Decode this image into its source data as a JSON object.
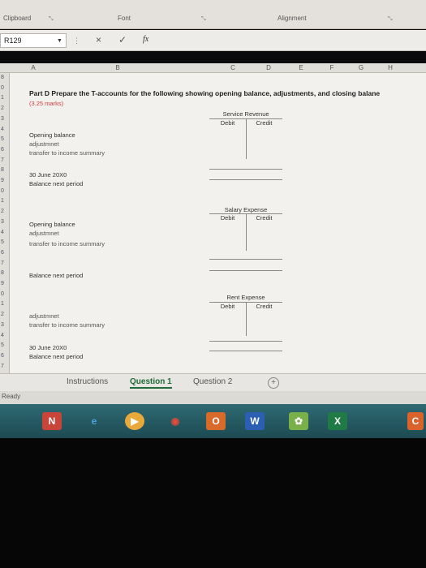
{
  "ribbon": {
    "groups": [
      "Clipboard",
      "Font",
      "Alignment"
    ]
  },
  "formula_bar": {
    "name_box": "R129",
    "cancel": "×",
    "enter": "✓",
    "fx": "fx"
  },
  "columns": [
    "A",
    "B",
    "C",
    "D",
    "E",
    "F",
    "G",
    "H"
  ],
  "rows": [
    "8",
    "0",
    "1",
    "2",
    "3",
    "4",
    "5",
    "6",
    "7",
    "8",
    "9",
    "0",
    "1",
    "2",
    "3",
    "4",
    "5",
    "6",
    "7",
    "8",
    "9",
    "0",
    "1",
    "2",
    "3",
    "4",
    "5",
    "6",
    "7"
  ],
  "sheet": {
    "title": "Part D Prepare the T-accounts for the following showing opening balance, adjustments, and closing balane",
    "marks": "(3.25 marks)",
    "accounts": [
      {
        "name": "Service Revenue",
        "debit": "Debit",
        "credit": "Credit",
        "lines": [
          "Opening balance",
          "adjustmnet",
          "transfer to income summary",
          "30 June 20X0",
          "Balance next period"
        ]
      },
      {
        "name": "Salary Expense",
        "debit": "Debit",
        "credit": "Credit",
        "lines": [
          "Opening balance",
          "adjustmnet",
          "transfer to income summary",
          "Balance next period"
        ]
      },
      {
        "name": "Rent Expense",
        "debit": "Debit",
        "credit": "Credit",
        "lines": [
          "adjustmnet",
          "transfer to income summary",
          "30 June 20X0",
          "Balance next period"
        ]
      }
    ]
  },
  "tabs": [
    "Instructions",
    "Question 1",
    "Question 2"
  ],
  "active_tab": "Question 1",
  "add_sheet": "+",
  "status": "Ready",
  "taskbar_apps": [
    "N",
    "e",
    "▶",
    "◉",
    "O",
    "W",
    "✿",
    "X",
    "C"
  ]
}
